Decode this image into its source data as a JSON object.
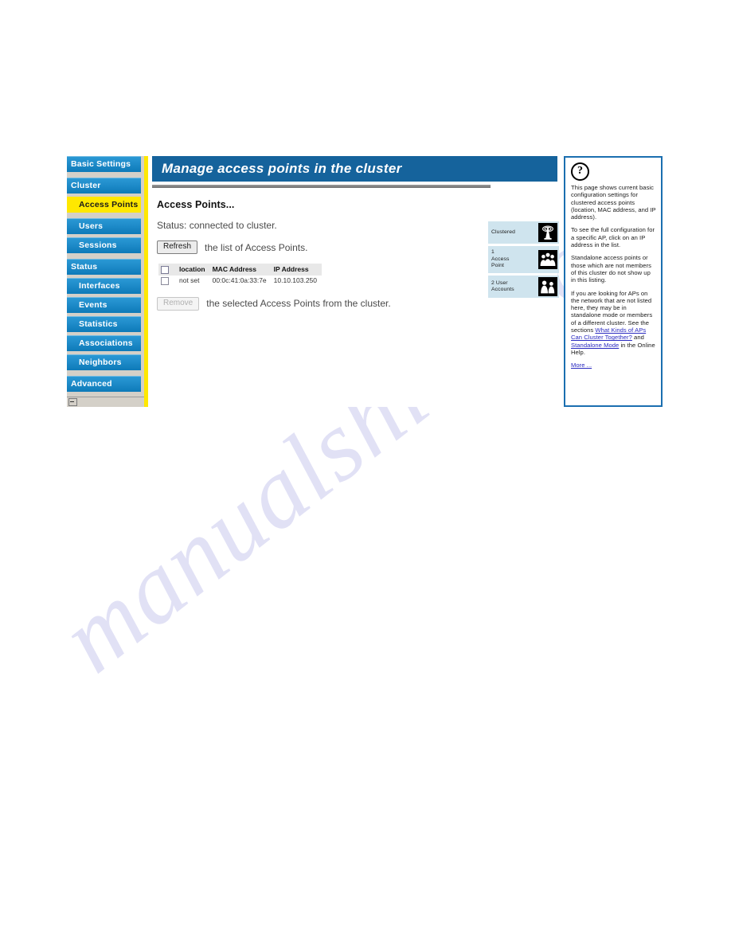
{
  "watermark": {
    "text": "manualshive.com"
  },
  "sidebar": {
    "items": [
      {
        "label": "Basic Settings",
        "level": "top",
        "active": false,
        "group_start": false
      },
      {
        "label": "Cluster",
        "level": "top",
        "active": false,
        "group_start": true
      },
      {
        "label": "Access Points",
        "level": "sub",
        "active": true,
        "group_start": false
      },
      {
        "label": "Users",
        "level": "sub",
        "active": false,
        "group_start": true
      },
      {
        "label": "Sessions",
        "level": "sub",
        "active": false,
        "group_start": false
      },
      {
        "label": "Status",
        "level": "top",
        "active": false,
        "group_start": true
      },
      {
        "label": "Interfaces",
        "level": "sub",
        "active": false,
        "group_start": false
      },
      {
        "label": "Events",
        "level": "sub",
        "active": false,
        "group_start": false
      },
      {
        "label": "Statistics",
        "level": "sub",
        "active": false,
        "group_start": false
      },
      {
        "label": "Associations",
        "level": "sub",
        "active": false,
        "group_start": false
      },
      {
        "label": "Neighbors",
        "level": "sub",
        "active": false,
        "group_start": false
      },
      {
        "label": "Advanced",
        "level": "top",
        "active": false,
        "group_start": true
      }
    ]
  },
  "page": {
    "title": "Manage access points in the cluster",
    "section_heading": "Access Points...",
    "status_line": "Status: connected to cluster.",
    "refresh_button": "Refresh",
    "refresh_text": "the list of Access Points.",
    "remove_button": "Remove",
    "remove_text": "the selected Access Points from the cluster."
  },
  "ap_table": {
    "columns": [
      "location",
      "MAC Address",
      "IP Address"
    ],
    "rows": [
      {
        "location": "not set",
        "mac": "00:0c:41:0a:33:7e",
        "ip": "10.10.103.250"
      }
    ]
  },
  "status_boxes": [
    {
      "label": "Clustered",
      "icon": "antenna-icon"
    },
    {
      "label": "1\nAccess\nPoint",
      "icon": "users-group-icon"
    },
    {
      "label": "2 User\nAccounts",
      "icon": "user-accounts-icon"
    }
  ],
  "help": {
    "question_mark": "?",
    "paragraphs": [
      "This page shows current basic configuration settings for clustered access points (location, MAC address, and IP address).",
      "To see the full configuration for a specific AP, click on an IP address in the list.",
      "Standalone access points or those which are not members of this cluster do not show up in this listing."
    ],
    "para4_before": "If you are looking for APs on the network that are not listed here, they may be in standalone mode or members of a different cluster. See the sections ",
    "link1": "What Kinds of APs Can Cluster Together?",
    "para4_mid": " and ",
    "link2": "Standalone Mode",
    "para4_after": " in the Online Help.",
    "more_link": "More ..."
  },
  "colors": {
    "header_blue": "#15639c",
    "nav_blue": "#1f8cca",
    "accent_yellow": "#ffe800",
    "status_box_bg": "#cfe4ee",
    "help_border": "#1b6fb0",
    "link": "#2a2ac0"
  }
}
